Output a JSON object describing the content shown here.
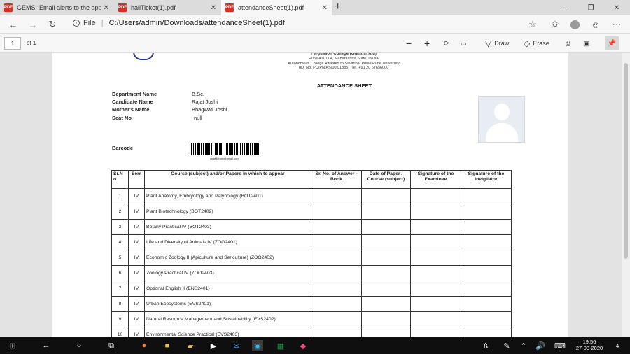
{
  "browser": {
    "tabs": [
      {
        "title": "GEMS- Email alerts to the appro",
        "active": false
      },
      {
        "title": "hallTicket(1).pdf",
        "active": false
      },
      {
        "title": "attendanceSheet(1).pdf",
        "active": true
      }
    ],
    "address": {
      "scheme_label": "File",
      "url": "C:/Users/admin/Downloads/attendanceSheet(1).pdf"
    }
  },
  "pdf_toolbar": {
    "page_number": "1",
    "page_count_label": "of 1",
    "draw_label": "Draw",
    "erase_label": "Erase"
  },
  "document": {
    "college_name": "Fergusson College (Grant in Aid)",
    "address_line": "Pune 411 004, Maharashtra State, INDIA",
    "affiliation": "Autonomous College Affiliated to Savitribai Phule Pune University",
    "id_line": "(ID. No. PU/PN/AS/002/1885) ,Tel. +91 20 67656000",
    "title": "ATTENDANCE SHEET",
    "fields": [
      {
        "label": "Department Name",
        "value": "B.Sc."
      },
      {
        "label": "Candidate Name",
        "value": "Rajat Joshi"
      },
      {
        "label": "Mother's Name",
        "value": "Bhagwati Joshi"
      },
      {
        "label": "Seat No",
        "value": "null"
      }
    ],
    "barcode_label": "Barcode",
    "barcode_text": "rajat89rom@gmail.com",
    "table": {
      "headers": [
        "Sr.N o",
        "Sem",
        "Course (subject) and/or Papers in which to appear",
        "Sr. No. of Answer - Book",
        "Date of Paper / Course (subject)",
        "Signature of the Examinee",
        "Signature of the Invigilator"
      ],
      "rows": [
        {
          "sr": "1",
          "sem": "IV",
          "course": "Plant Anatomy, Embryology and Palynology (BOT2401)"
        },
        {
          "sr": "2",
          "sem": "IV",
          "course": "Plant Biotechnology (BOT2402)"
        },
        {
          "sr": "3",
          "sem": "IV",
          "course": "Botany Practical IV (BOT2403)"
        },
        {
          "sr": "4",
          "sem": "IV",
          "course": "Life and Diversity of Animals IV (ZOO2401)"
        },
        {
          "sr": "5",
          "sem": "IV",
          "course": "Economic Zoology II  (Apiculture and Sericulture) (ZOO2402)"
        },
        {
          "sr": "6",
          "sem": "IV",
          "course": "Zoology Practical IV (ZOO2403)"
        },
        {
          "sr": "7",
          "sem": "IV",
          "course": "Optional English II (ENS2401)"
        },
        {
          "sr": "8",
          "sem": "IV",
          "course": "Urban Ecosystems  (EVS2401)"
        },
        {
          "sr": "9",
          "sem": "IV",
          "course": "Natural Resource Management and Sustainability (EVS2402)"
        },
        {
          "sr": "10",
          "sem": "IV",
          "course": "Environmental Science Practical (EVS2403)"
        }
      ]
    }
  },
  "taskbar": {
    "time": "19:56",
    "date": "27-03-2020",
    "notification_count": "4"
  }
}
